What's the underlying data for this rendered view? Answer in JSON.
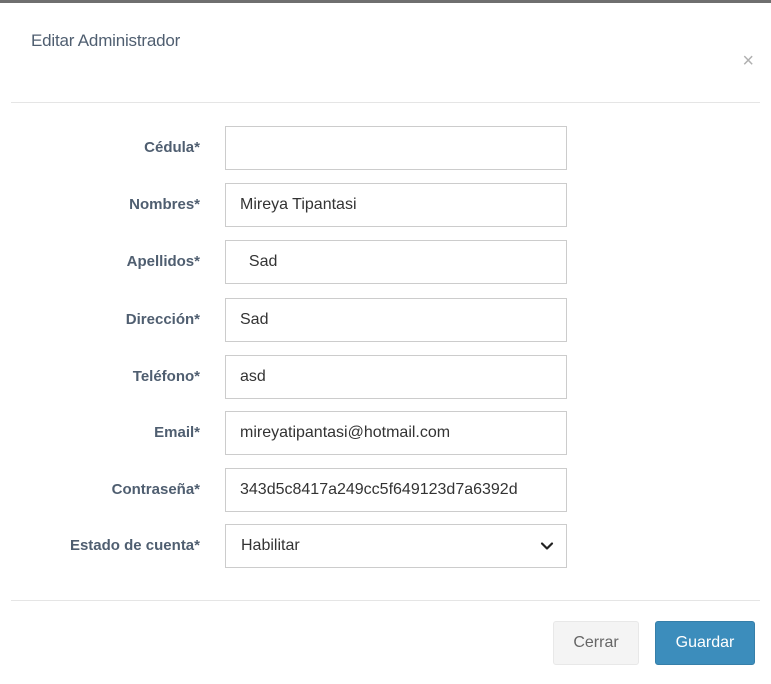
{
  "modal": {
    "title": "Editar Administrador",
    "close_symbol": "×",
    "close_icon": "close-icon"
  },
  "form": {
    "cedula": {
      "label": "Cédula*",
      "value": ""
    },
    "nombres": {
      "label": "Nombres*",
      "value": "Mireya Tipantasi"
    },
    "apellidos": {
      "label": "Apellidos*",
      "value": "  Sad"
    },
    "direccion": {
      "label": "Dirección*",
      "value": "Sad"
    },
    "telefono": {
      "label": "Teléfono*",
      "value": "asd"
    },
    "email": {
      "label": "Email*",
      "value": "mireyatipantasi@hotmail.com"
    },
    "contrasena": {
      "label": "Contraseña*",
      "value": "343d5c8417a249cc5f649123d7a6392d"
    },
    "estado": {
      "label": "Estado de cuenta*",
      "value": "Habilitar",
      "icon": "chevron-down-icon"
    }
  },
  "footer": {
    "close_label": "Cerrar",
    "save_label": "Guardar"
  },
  "colors": {
    "primary": "#3c8dbc",
    "label": "#4f5e70",
    "border": "#cccccc"
  }
}
